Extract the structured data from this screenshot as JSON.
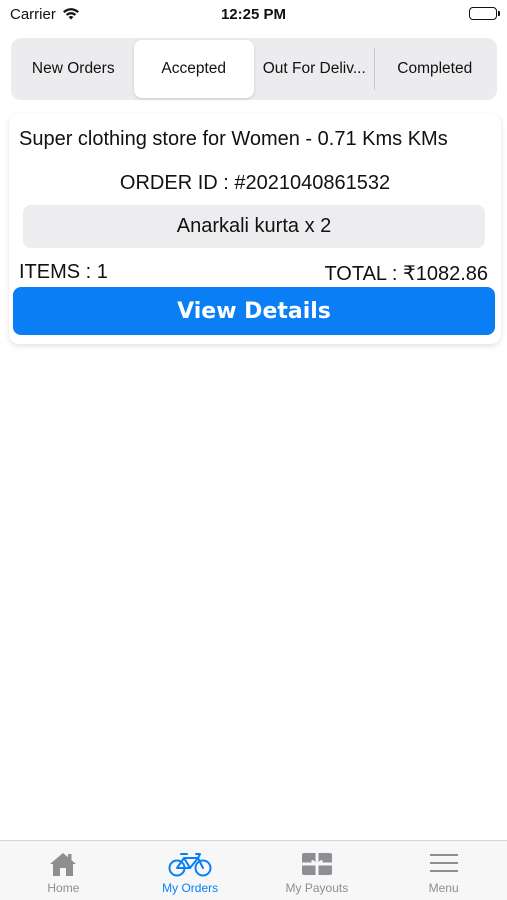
{
  "status_bar": {
    "carrier": "Carrier",
    "time": "12:25 PM"
  },
  "tabs": [
    {
      "label": "New Orders",
      "active": false
    },
    {
      "label": "Accepted",
      "active": true
    },
    {
      "label": "Out For Deliv...",
      "active": false
    },
    {
      "label": "Completed",
      "active": false
    }
  ],
  "order": {
    "store": "Super clothing store for Women - 0.71 Kms KMs",
    "order_id": "ORDER ID : #2021040861532",
    "item": "Anarkali kurta x 2",
    "items_count": "ITEMS : 1",
    "total": "TOTAL : ₹1082.86",
    "view_button": "View Details"
  },
  "bottom_nav": [
    {
      "label": "Home",
      "icon": "home-icon",
      "active": false
    },
    {
      "label": "My Orders",
      "icon": "bicycle-icon",
      "active": true
    },
    {
      "label": "My Payouts",
      "icon": "gift-card-icon",
      "active": false
    },
    {
      "label": "Menu",
      "icon": "menu-icon",
      "active": false
    }
  ],
  "colors": {
    "accent": "#0a7ff5",
    "inactive_tab": "#8e8e93"
  }
}
